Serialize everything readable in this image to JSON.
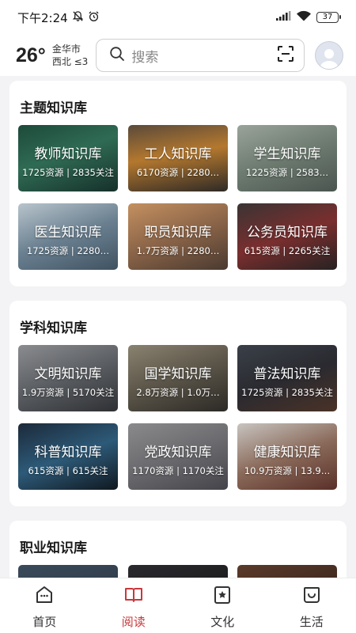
{
  "status_bar": {
    "time": "下午2:24",
    "battery": "37"
  },
  "header": {
    "temperature": "26°",
    "city": "金华市",
    "wind": "西北 ≤3",
    "search_placeholder": "搜索"
  },
  "sections": [
    {
      "title": "主题知识库",
      "items": [
        {
          "name": "教师知识库",
          "stats": "1725资源 | 2835关注"
        },
        {
          "name": "工人知识库",
          "stats": "6170资源 | 2280…"
        },
        {
          "name": "学生知识库",
          "stats": "1225资源 | 2583…"
        },
        {
          "name": "医生知识库",
          "stats": "1725资源 | 2280…"
        },
        {
          "name": "职员知识库",
          "stats": "1.7万资源 | 2280…"
        },
        {
          "name": "公务员知识库",
          "stats": "615资源 | 2265关注"
        }
      ]
    },
    {
      "title": "学科知识库",
      "items": [
        {
          "name": "文明知识库",
          "stats": "1.9万资源 | 5170关注"
        },
        {
          "name": "国学知识库",
          "stats": "2.8万资源 | 1.0万…"
        },
        {
          "name": "普法知识库",
          "stats": "1725资源 | 2835关注"
        },
        {
          "name": "科普知识库",
          "stats": "615资源 | 615关注"
        },
        {
          "name": "党政知识库",
          "stats": "1170资源 | 1170关注"
        },
        {
          "name": "健康知识库",
          "stats": "10.9万资源 | 13.9…"
        }
      ]
    },
    {
      "title": "职业知识库",
      "items": []
    }
  ],
  "nav": [
    {
      "label": "首页",
      "icon": "home-icon"
    },
    {
      "label": "阅读",
      "icon": "book-icon",
      "active": true
    },
    {
      "label": "文化",
      "icon": "culture-icon"
    },
    {
      "label": "生活",
      "icon": "life-icon"
    }
  ],
  "colors": {
    "accent": "#c8383b",
    "background": "#f3f3f5"
  }
}
